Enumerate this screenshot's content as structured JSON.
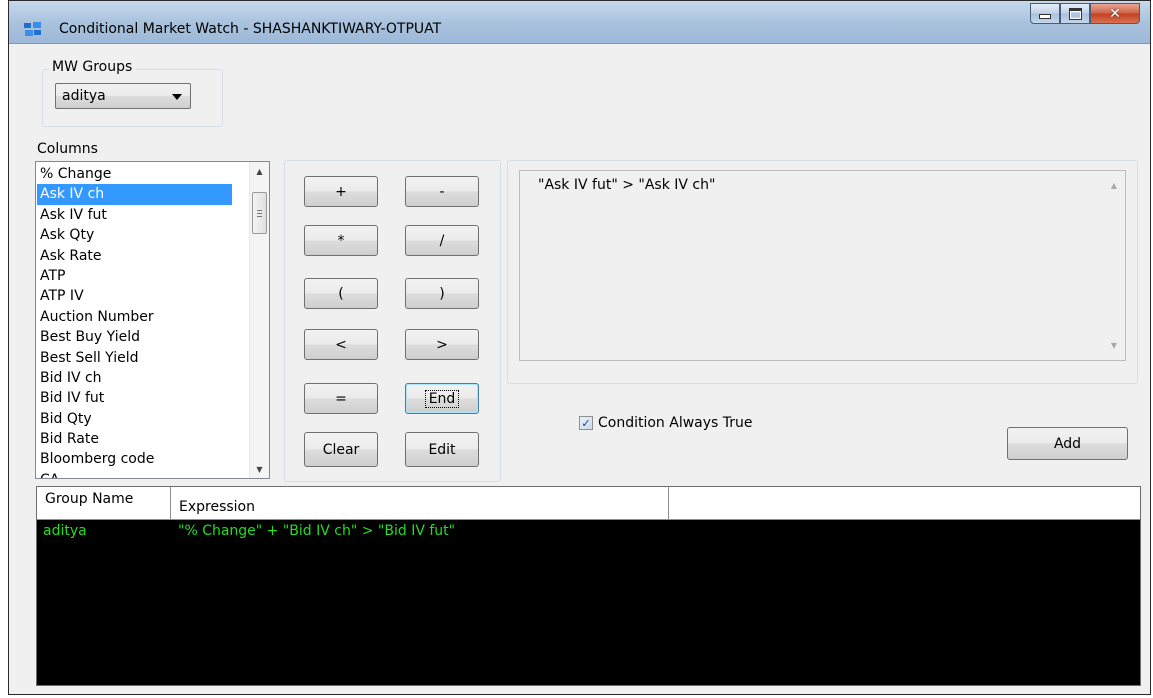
{
  "window": {
    "title": "Conditional Market Watch - SHASHANKTIWARY-OTPUAT",
    "controls": {
      "minimize": "minimize",
      "maximize": "maximize",
      "close": "✕"
    }
  },
  "mw_groups": {
    "legend": "MW Groups",
    "selected": "aditya"
  },
  "columns": {
    "label": "Columns",
    "items": [
      "% Change",
      "Ask IV ch",
      "Ask IV fut",
      "Ask Qty",
      "Ask Rate",
      "ATP",
      "ATP IV",
      "Auction Number",
      "Best Buy Yield",
      "Best Sell Yield",
      "Bid IV ch",
      "Bid IV fut",
      "Bid Qty",
      "Bid Rate",
      "Bloomberg code",
      "CA"
    ],
    "selected_index": 1
  },
  "operators": {
    "plus": "+",
    "minus": "-",
    "multiply": "*",
    "divide": "/",
    "open_paren": "(",
    "close_paren": ")",
    "less_than": "<",
    "greater_than": ">",
    "equals": "=",
    "end": "End",
    "clear": "Clear",
    "edit": "Edit"
  },
  "expression": {
    "text": "\"Ask IV fut\" > \"Ask IV ch\""
  },
  "condition_checkbox": {
    "label": "Condition Always True",
    "checked": true
  },
  "add_button": "Add",
  "grid": {
    "headers": [
      "Group Name",
      "Expression",
      ""
    ],
    "rows": [
      {
        "group": "aditya",
        "expression": "\"% Change\" + \"Bid IV ch\" > \"Bid IV fut\""
      }
    ],
    "text_color": "#22dd22",
    "background": "#000000"
  },
  "colors": {
    "selection": "#3399ff",
    "window_bg": "#f0f0f0"
  }
}
